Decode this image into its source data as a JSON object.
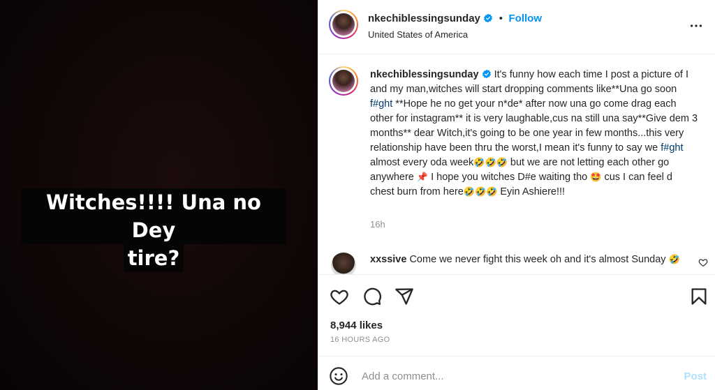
{
  "media": {
    "caption_line1": "Witches!!!! Una no Dey",
    "caption_line2": "tire?"
  },
  "header": {
    "username": "nkechiblessingsunday",
    "separator": "•",
    "follow_label": "Follow",
    "location": "United States of America",
    "more_icon": "more-horizontal-icon"
  },
  "caption": {
    "username": "nkechiblessingsunday",
    "text_part1": "It's funny how each time I post a picture of I and my man,witches will start dropping comments like**Una go soon ",
    "link1": "f#ght",
    "text_part2": " **Hope he no get your n*de* after now una go come drag each other for instagram** it is very laughable,cus na still una say**Give dem 3 months** dear Witch,it's going to be one year in few months...this very relationship have been thru the worst,I mean it's funny to say we ",
    "link2": "f#ght",
    "text_part3": " almost every oda week",
    "emoji_laugh": "🤣",
    "text_part4": " but we are not letting each other go anywhere ",
    "emoji_pin": "📌",
    "text_part5": " I hope you witches D#e waiting tho ",
    "emoji_starstruck": "🤩",
    "text_part6": " cus I can feel d chest burn from here",
    "text_part7": " Eyin Ashiere!!!",
    "time": "16h"
  },
  "comment": {
    "username": "xxssive",
    "text": "Come we never fight this week oh and it's almost Sunday ",
    "emoji": "🤣"
  },
  "actions": {
    "like_icon": "heart-icon",
    "comment_icon": "comment-icon",
    "share_icon": "share-icon",
    "save_icon": "bookmark-icon"
  },
  "likes": "8,944 likes",
  "age": "16 HOURS AGO",
  "comment_bar": {
    "placeholder": "Add a comment...",
    "post_label": "Post",
    "emoji_icon": "smiley-icon"
  },
  "colors": {
    "accent": "#0095f6",
    "post_disabled": "#b2dffc",
    "link": "#00376b",
    "muted": "#8e8e8e"
  }
}
